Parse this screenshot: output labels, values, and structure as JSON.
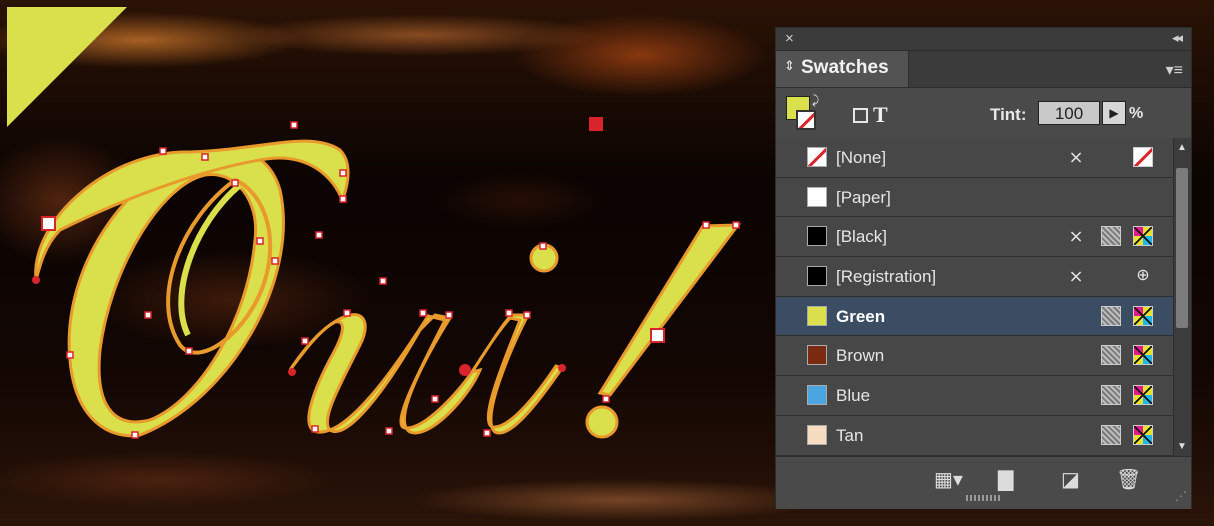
{
  "panel": {
    "title": "Swatches",
    "tab_arrows": "⇕",
    "close_glyph": "×",
    "collapse_glyph": "◂◂",
    "menu_glyph": "▾≡",
    "tint_label": "Tint:",
    "tint_value": "100",
    "tint_unit": "%",
    "text_glyph": "T",
    "swatches": [
      {
        "name": "[None]",
        "chip": "none",
        "icons": [
          "lock-icon",
          "none-icon"
        ]
      },
      {
        "name": "[Paper]",
        "chip": "#ffffff",
        "icons": []
      },
      {
        "name": "[Black]",
        "chip": "#000000",
        "icons": [
          "lock-icon",
          "process-icon",
          "cmyk-icon"
        ]
      },
      {
        "name": "[Registration]",
        "chip": "#000000",
        "icons": [
          "lock-icon",
          "registration-icon"
        ]
      },
      {
        "name": "Green",
        "chip": "#d9e04b",
        "icons": [
          "process-icon",
          "cmyk-icon"
        ],
        "selected": true
      },
      {
        "name": "Brown",
        "chip": "#7a2b12",
        "icons": [
          "process-icon",
          "cmyk-icon"
        ]
      },
      {
        "name": "Blue",
        "chip": "#4aa5e0",
        "icons": [
          "process-icon",
          "cmyk-icon"
        ]
      },
      {
        "name": "Tan",
        "chip": "#f6dcc0",
        "icons": [
          "process-icon",
          "cmyk-icon"
        ]
      }
    ],
    "bottom_icons": [
      "show-options-icon",
      "new-group-icon",
      "new-swatch-icon",
      "delete-icon"
    ]
  },
  "artwork": {
    "text": "Oui!",
    "fill_color": "#d9e04b",
    "outline_color": "#e89a2c",
    "anchor_color": "#d8242a"
  },
  "colors": {
    "accent_green": "#d9e04b",
    "panel_bg": "#4a4a4a",
    "selected_row": "#3a4d63"
  }
}
